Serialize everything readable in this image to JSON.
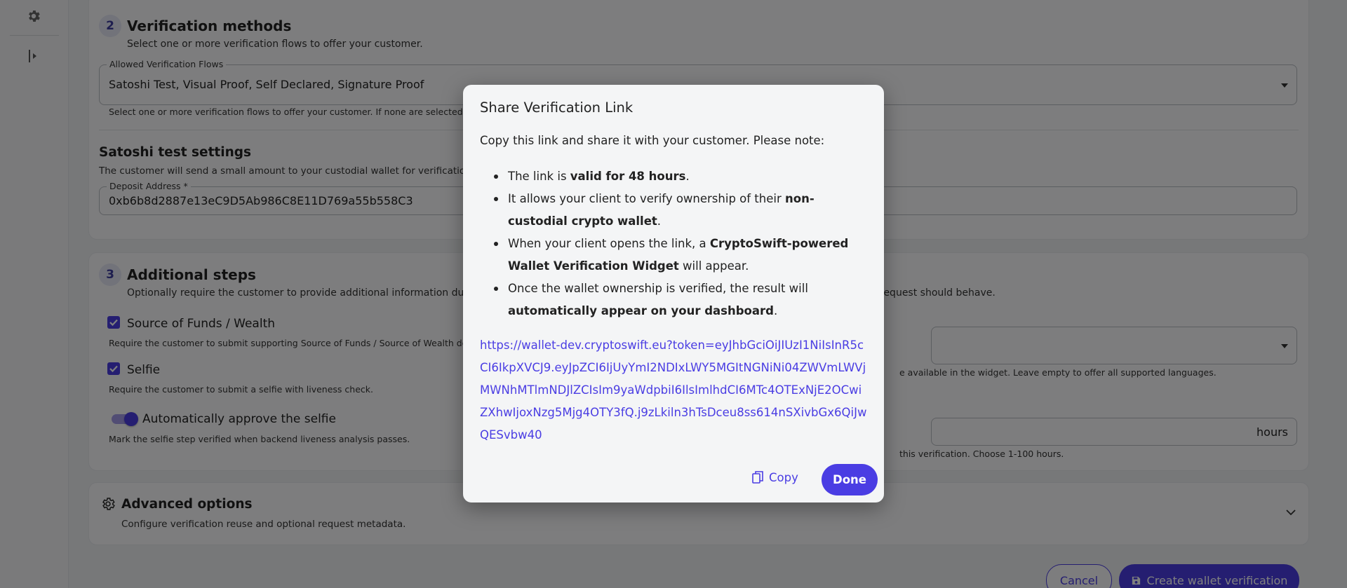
{
  "step2": {
    "number": "2",
    "title": "Verification methods",
    "subtitle": "Select one or more verification flows to offer your customer.",
    "flows_label": "Allowed Verification Flows",
    "flows_value": "Satoshi Test, Visual Proof, Self Declared, Signature Proof",
    "flows_helper": "Select one or more verification flows to offer your customer. If none are selected, Cryp",
    "satoshi_title": "Satoshi test settings",
    "satoshi_sub": "The customer will send a small amount to your custodial wallet for verification.",
    "deposit_label": "Deposit Address *",
    "deposit_value": "0xb6b8d2887e13eC9D5Ab986C8E11D769a55b558C3"
  },
  "step3": {
    "number": "3",
    "title": "Additional steps",
    "subtitle_left": "Optionally require the customer to provide additional information during the",
    "subtitle_right": "request should behave.",
    "sof_label": "Source of Funds / Wealth",
    "sof_helper": "Require the customer to submit supporting Source of Funds / Source of Wealth docum",
    "selfie_label": "Selfie",
    "selfie_helper": "Require the customer to submit a selfie with liveness check.",
    "auto_label": "Automatically approve the selfie",
    "auto_helper": "Mark the selfie step verified when backend liveness analysis passes.",
    "lang_helper": "e available in the widget. Leave empty to offer all supported languages.",
    "hours_unit": "hours",
    "hours_helper": "this verification. Choose 1-100 hours."
  },
  "advanced": {
    "title": "Advanced options",
    "subtitle": "Configure verification reuse and optional request metadata."
  },
  "footer": {
    "cancel": "Cancel",
    "create": "Create wallet verification"
  },
  "dialog": {
    "title": "Share Verification Link",
    "intro": "Copy this link and share it with your customer. Please note:",
    "b1_pre": "The link is ",
    "b1_bold": "valid for 48 hours",
    "b1_post": ".",
    "b2_pre": "It allows your client to verify ownership of their ",
    "b2_bold": "non-custodial crypto wallet",
    "b2_post": ".",
    "b3_pre": "When your client opens the link, a ",
    "b3_bold": "CryptoSwift-powered Wallet Verification Widget",
    "b3_post": " will appear.",
    "b4_pre": "Once the wallet ownership is verified, the result will ",
    "b4_bold": "automatically appear on your dashboard",
    "b4_post": ".",
    "link": "https://wallet-dev.cryptoswift.eu?token=eyJhbGciOiJIUzI1NiIsInR5cCI6IkpXVCJ9.eyJpZCI6IjUyYmI2NDIxLWY5MGItNGNiNi04ZWVmLWVjMWNhMTlmNDJlZCIsIm9yaWdpbiI6IlsImlhdCI6MTc4OTExNjE2OCwiZXhwIjoxNzg5Mjg4OTY3fQ.j9zLkiln3hTsDceu8ss614nSXivbGx6QiJwQESvbw40",
    "copy": "Copy",
    "done": "Done"
  }
}
